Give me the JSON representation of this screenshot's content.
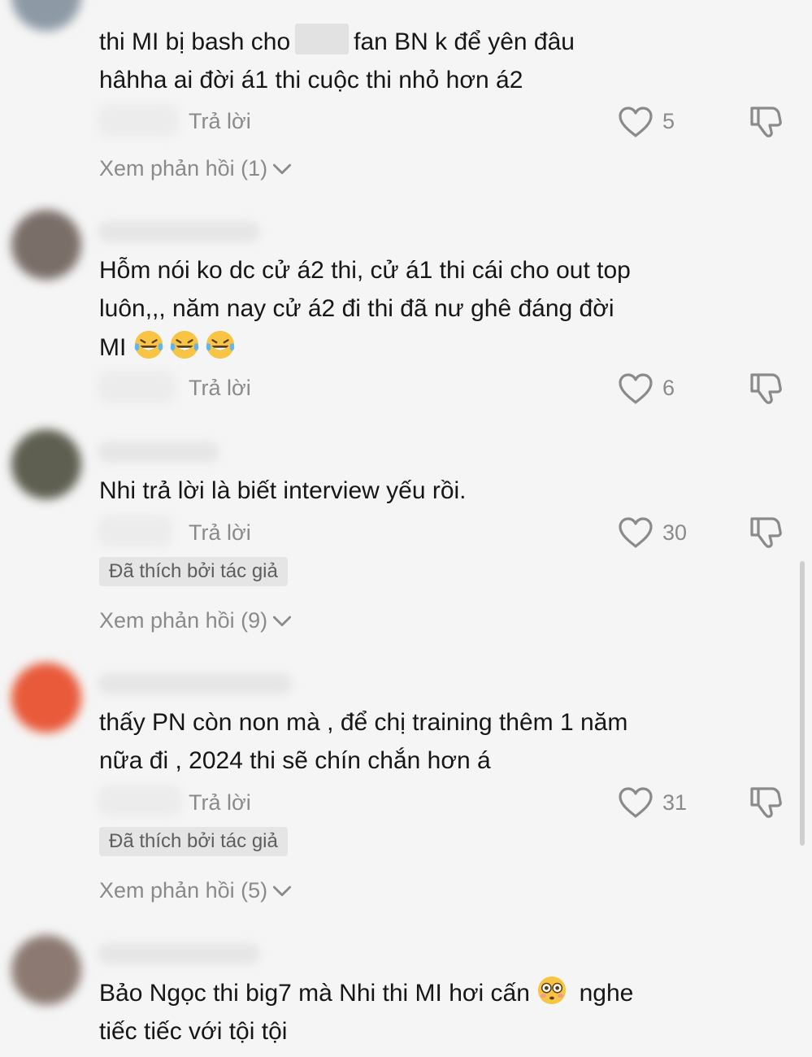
{
  "comments": [
    {
      "text_line1_pre": "thi MI bị bash cho",
      "text_line1_post": "fan BN k để yên đâu",
      "text_line2": "hâhha ai đời á1 thi cuộc thi nhỏ hơn á2",
      "reply_label": "Trả lời",
      "like_count": "5",
      "view_replies_label": "Xem phản hồi (1)"
    },
    {
      "text_line1": "Hỗm nói ko dc cử á2 thi, cử á1 thi cái cho out top",
      "text_line2": "luôn,,, năm nay cử á2 đi thi đã nư ghê đáng đời",
      "text_line3": "MI",
      "emoji": "face-with-tears-of-joy",
      "reply_label": "Trả lời",
      "like_count": "6"
    },
    {
      "text_line1": "Nhi trả lời là biết interview yếu rồi.",
      "reply_label": "Trả lời",
      "like_count": "30",
      "author_badge": "Đã thích bởi tác giả",
      "view_replies_label": "Xem phản hồi (9)"
    },
    {
      "text_line1": "thấy PN còn non mà , để chị training thêm 1 năm",
      "text_line2": "nữa đi , 2024 thi sẽ chín chắn hơn á",
      "reply_label": "Trả lời",
      "like_count": "31",
      "author_badge": "Đã thích bởi tác giả",
      "view_replies_label": "Xem phản hồi (5)"
    },
    {
      "text_line1_pre": "Bảo Ngọc thi big7 mà Nhi thi MI hơi cấn",
      "text_line1_post": "nghe",
      "emoji": "flushed-face",
      "text_line2": "tiếc tiếc với tội tội"
    }
  ],
  "colors": {
    "background": "#f5f5f5",
    "text": "#161616",
    "secondary_text": "#8a8a8a",
    "badge_bg": "#e5e5e5",
    "avatar_4": "#e85a3a"
  },
  "icons": [
    "heart-outline-icon",
    "thumbs-down-outline-icon",
    "chevron-down-icon"
  ]
}
